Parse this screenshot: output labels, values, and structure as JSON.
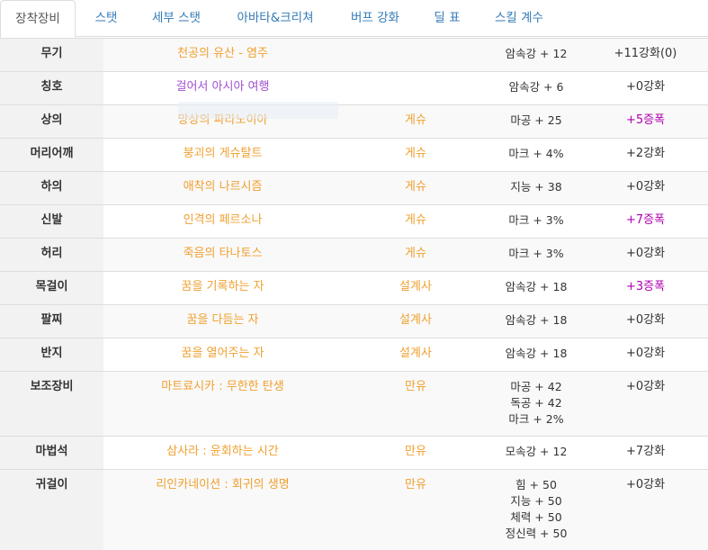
{
  "tabs": [
    {
      "label": "장착장비",
      "active": true
    },
    {
      "label": "스탯",
      "active": false
    },
    {
      "label": "세부 스탯",
      "active": false
    },
    {
      "label": "아바타&크리쳐",
      "active": false
    },
    {
      "label": "버프 강화",
      "active": false
    },
    {
      "label": "딜 표",
      "active": false
    },
    {
      "label": "스킬 계수",
      "active": false
    }
  ],
  "rows": [
    {
      "slot": "무기",
      "name": "천공의 유산 - 염주",
      "set": "",
      "stats": [
        "암속강 + 12"
      ],
      "enhance": "+11강화(0)"
    },
    {
      "slot": "칭호",
      "name": "걸어서 아시아 여행",
      "set": "",
      "stats": [
        "암속강 + 6"
      ],
      "enhance": "+0강화"
    },
    {
      "slot": "상의",
      "name": "망상의 파라노이아",
      "set": "게슈",
      "stats": [
        "마공 + 25"
      ],
      "enhance": "+5증폭"
    },
    {
      "slot": "머리어깨",
      "name": "붕괴의 게슈탈트",
      "set": "게슈",
      "stats": [
        "마크 + 4%"
      ],
      "enhance": "+2강화"
    },
    {
      "slot": "하의",
      "name": "애착의 나르시즘",
      "set": "게슈",
      "stats": [
        "지능 + 38"
      ],
      "enhance": "+0강화"
    },
    {
      "slot": "신발",
      "name": "인격의 페르소나",
      "set": "게슈",
      "stats": [
        "마크 + 3%"
      ],
      "enhance": "+7증폭"
    },
    {
      "slot": "허리",
      "name": "죽음의 타나토스",
      "set": "게슈",
      "stats": [
        "마크 + 3%"
      ],
      "enhance": "+0강화"
    },
    {
      "slot": "목걸이",
      "name": "꿈을 기록하는 자",
      "set": "설계사",
      "stats": [
        "암속강 + 18"
      ],
      "enhance": "+3증폭"
    },
    {
      "slot": "팔찌",
      "name": "꿈을 다듬는 자",
      "set": "설계사",
      "stats": [
        "암속강 + 18"
      ],
      "enhance": "+0강화"
    },
    {
      "slot": "반지",
      "name": "꿈을 열어주는 자",
      "set": "설계사",
      "stats": [
        "암속강 + 18"
      ],
      "enhance": "+0강화"
    },
    {
      "slot": "보조장비",
      "name": "마트료시카 : 무한한 탄생",
      "set": "만유",
      "stats": [
        "마공 + 42",
        "독공 + 42",
        "마크 + 2%"
      ],
      "enhance": "+0강화"
    },
    {
      "slot": "마법석",
      "name": "삼사라 : 윤회하는 시간",
      "set": "만유",
      "stats": [
        "모속강 + 12"
      ],
      "enhance": "+7강화"
    },
    {
      "slot": "귀걸이",
      "name": "리인카네이션 : 회귀의 생명",
      "set": "만유",
      "stats": [
        "힘 + 50",
        "지능 + 50",
        "체력 + 50",
        "정신력 + 50"
      ],
      "enhance": "+0강화"
    }
  ],
  "colors": {
    "item_name": "#f0a030",
    "title_name": "#a050d0",
    "amplify": "#b000b0",
    "tab_link": "#337ab7"
  }
}
